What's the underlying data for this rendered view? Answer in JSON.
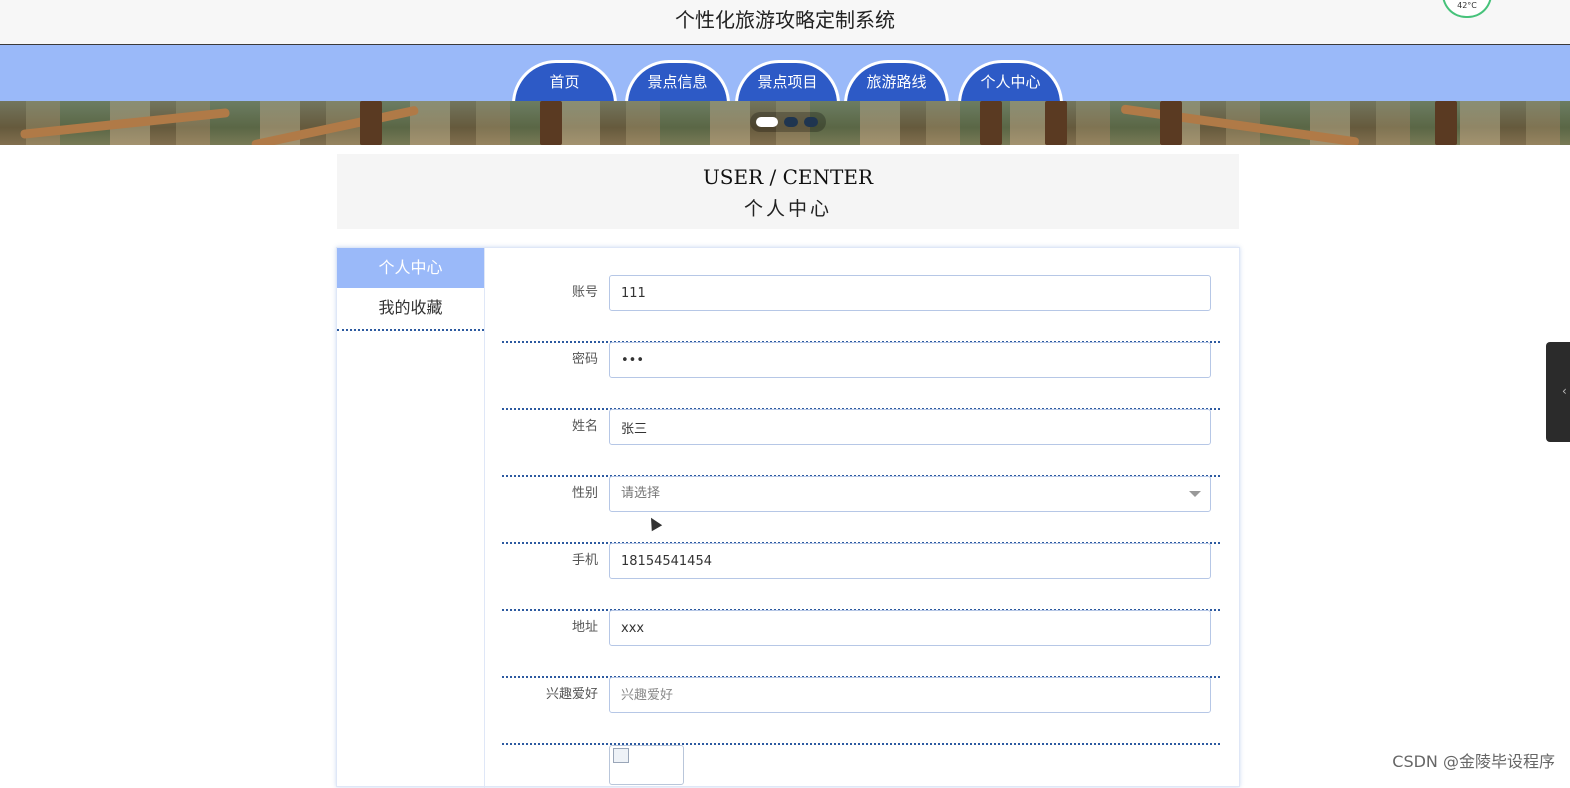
{
  "header": {
    "site_title": "个性化旅游攻略定制系统",
    "weather_text": "42°C"
  },
  "nav": {
    "items": [
      {
        "label": "首页"
      },
      {
        "label": "景点信息"
      },
      {
        "label": "景点项目"
      },
      {
        "label": "旅游路线"
      },
      {
        "label": "个人中心"
      }
    ]
  },
  "carousel": {
    "dot_count": 3,
    "active_index": 0
  },
  "section": {
    "title_en": "USER / CENTER",
    "title_cn": "个人中心"
  },
  "sidebar": {
    "items": [
      {
        "label": "个人中心",
        "active": true
      },
      {
        "label": "我的收藏",
        "active": false
      }
    ]
  },
  "form": {
    "account": {
      "label": "账号",
      "value": "111"
    },
    "password": {
      "label": "密码",
      "value": "•••"
    },
    "name": {
      "label": "姓名",
      "value": "张三"
    },
    "gender": {
      "label": "性别",
      "placeholder": "请选择"
    },
    "phone": {
      "label": "手机",
      "value": "18154541454"
    },
    "address": {
      "label": "地址",
      "value": "xxx"
    },
    "hobby": {
      "label": "兴趣爱好",
      "placeholder": "兴趣爱好"
    }
  },
  "watermark": "CSDN @金陵毕设程序",
  "colors": {
    "nav_bg": "#9ab9f9",
    "nav_item": "#2d5ac6",
    "row_divider": "#2d5aa0"
  }
}
